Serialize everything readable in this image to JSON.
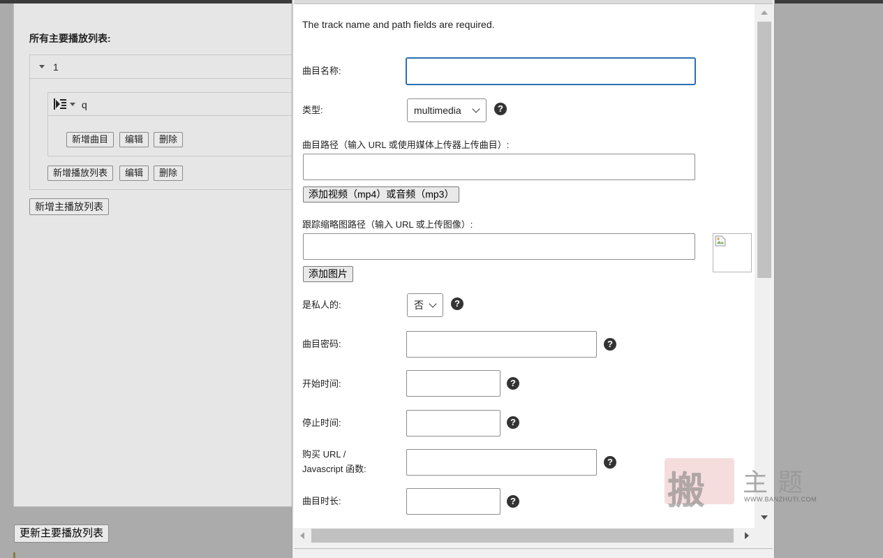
{
  "background": {
    "section_title": "所有主要播放列表:",
    "playlist_name": "1",
    "sub_playlist_name": "q",
    "sub_buttons": {
      "add_track": "新增曲目",
      "edit": "编辑",
      "delete": "删除"
    },
    "playlist_buttons": {
      "add_playlist": "新增播放列表",
      "edit": "编辑",
      "delete": "删除"
    },
    "add_main_playlist": "新增主播放列表",
    "update_main_playlist": "更新主要播放列表"
  },
  "dialog": {
    "required_note": "The track name and path fields are required.",
    "track_name": {
      "label": "曲目名称:",
      "value": ""
    },
    "type": {
      "label": "类型:",
      "value": "multimedia"
    },
    "track_path": {
      "label": "曲目路径（输入 URL 或使用媒体上传器上传曲目）:",
      "value": "",
      "button": "添加视频（mp4）或音频（mp3）"
    },
    "thumb_path": {
      "label": "跟踪缩略图路径（输入 URL 或上传图像）:",
      "value": "",
      "button": "添加图片"
    },
    "private": {
      "label": "是私人的:",
      "value": "否"
    },
    "password": {
      "label": "曲目密码:",
      "value": ""
    },
    "start_time": {
      "label": "开始时间:",
      "value": ""
    },
    "stop_time": {
      "label": "停止时间:",
      "value": ""
    },
    "buy_url": {
      "label_line1": "购买 URL /",
      "label_line2": "Javascript 函数:",
      "value": ""
    },
    "duration": {
      "label": "曲目时长:",
      "value": ""
    },
    "help_glyph": "?"
  },
  "watermark": {
    "seal_char": "搬",
    "text": "主题",
    "url": "WWW.BANZHUTI.COM"
  },
  "colors": {
    "focus_border": "#2a6fb0",
    "overlay_bg": "#ababab",
    "dialog_bg": "#ffffff"
  }
}
